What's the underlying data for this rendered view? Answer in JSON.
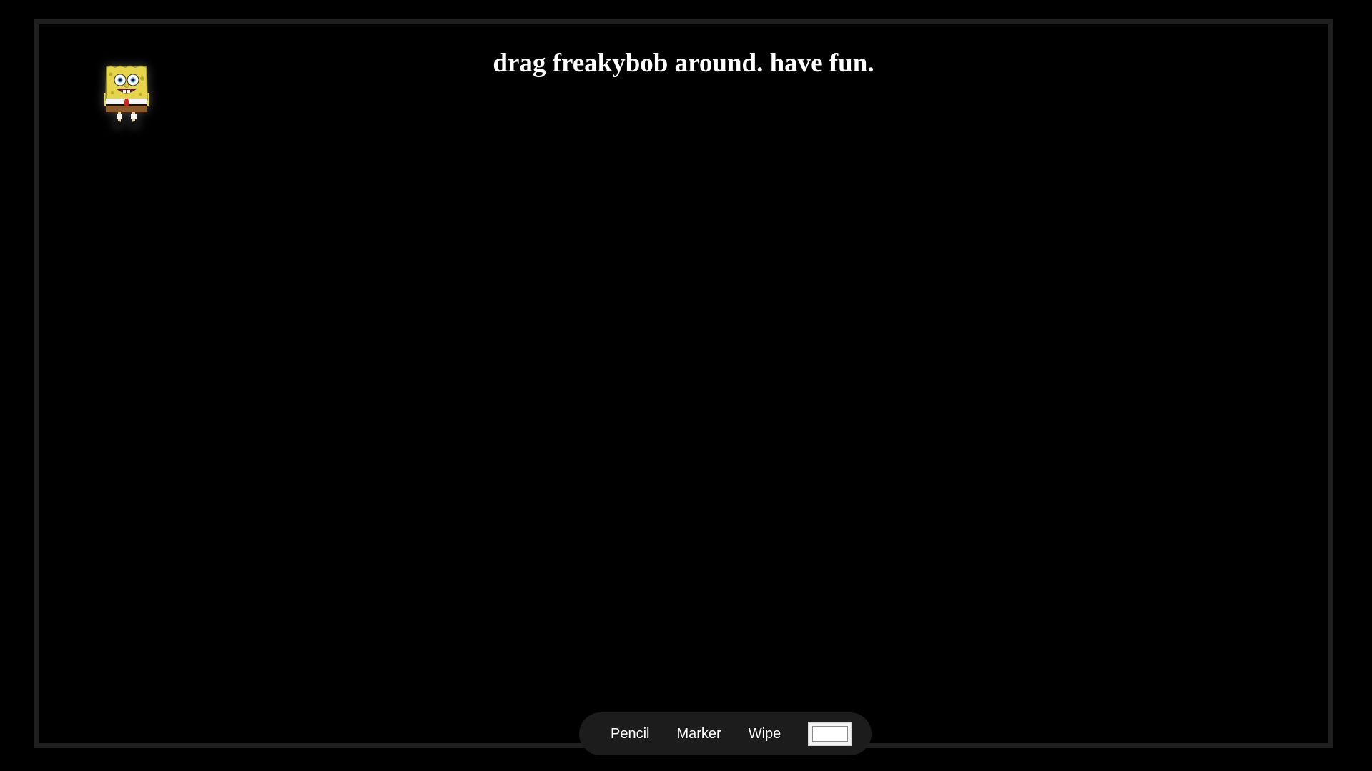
{
  "page": {
    "title": "drag freakybob around. have fun."
  },
  "sprite": {
    "icon": "spongebob-character-icon"
  },
  "toolbar": {
    "pencil_label": "Pencil",
    "marker_label": "Marker",
    "wipe_label": "Wipe",
    "color_value": "#ffffff"
  },
  "colors": {
    "background": "#000000",
    "frame_border": "#1f1f1f",
    "toolbar_bg": "#1c1c1c",
    "text": "#ffffff"
  }
}
